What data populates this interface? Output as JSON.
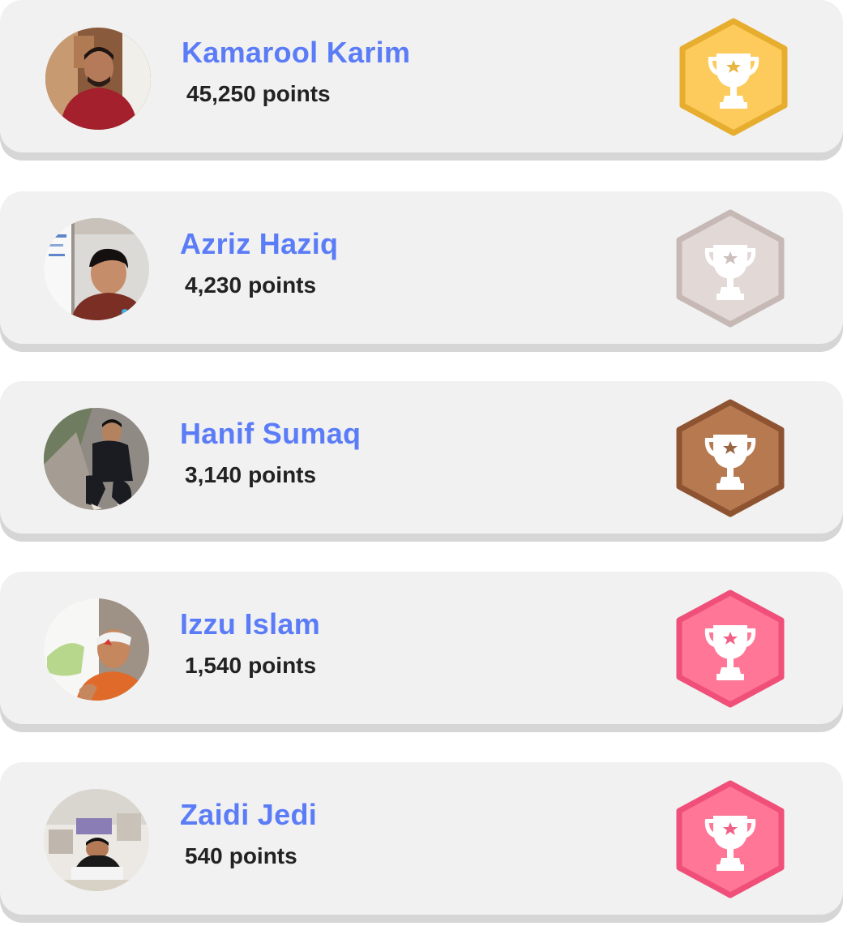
{
  "leaderboard": {
    "entries": [
      {
        "name": "Kamarool Karim",
        "points": "45,250",
        "points_unit": "points",
        "badge_tier": "gold",
        "badge_fill": "#fdcb5c",
        "badge_stroke": "#e6ad2e",
        "avatar_icon": "person-photo"
      },
      {
        "name": "Azriz Haziq",
        "points": "4,230",
        "points_unit": "points",
        "badge_tier": "silver",
        "badge_fill": "#e2d8d6",
        "badge_stroke": "#c6b8b5",
        "avatar_icon": "person-photo"
      },
      {
        "name": "Hanif Sumaq",
        "points": "3,140",
        "points_unit": "points",
        "badge_tier": "bronze",
        "badge_fill": "#b67950",
        "badge_stroke": "#8e5330",
        "avatar_icon": "person-photo"
      },
      {
        "name": "Izzu Islam",
        "points": "1,540",
        "points_unit": "points",
        "badge_tier": "participant",
        "badge_fill": "#ff7697",
        "badge_stroke": "#ef4f78",
        "avatar_icon": "person-photo"
      },
      {
        "name": "Zaidi Jedi",
        "points": "540",
        "points_unit": "points",
        "badge_tier": "participant",
        "badge_fill": "#ff7697",
        "badge_stroke": "#ef4f78",
        "avatar_icon": "person-photo"
      }
    ]
  }
}
